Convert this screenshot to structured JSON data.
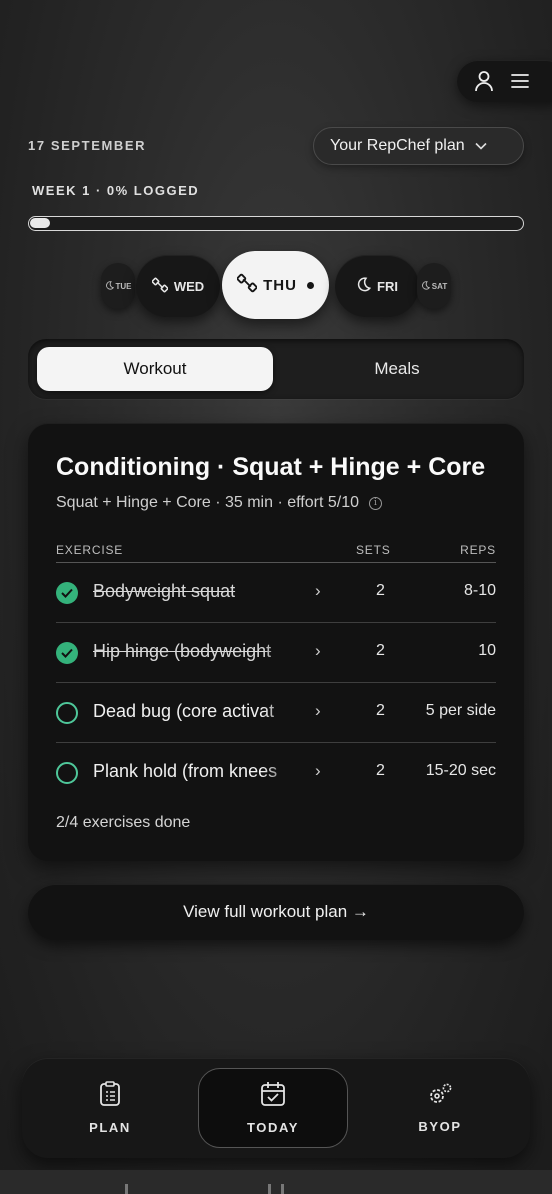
{
  "header": {
    "date": "17 SEPTEMBER",
    "plan_selector": "Your RepChef plan",
    "week_progress_label": "WEEK 1 · 0% LOGGED",
    "progress_fraction": 0.04
  },
  "days": [
    {
      "label": "TUE",
      "kind": "rest"
    },
    {
      "label": "WED",
      "kind": "workout"
    },
    {
      "label": "THU",
      "kind": "workout",
      "active": true
    },
    {
      "label": "FRI",
      "kind": "rest"
    },
    {
      "label": "SAT",
      "kind": "rest"
    }
  ],
  "tabs": {
    "workout": "Workout",
    "meals": "Meals"
  },
  "workout": {
    "title": "Conditioning · Squat + Hinge + Core",
    "subtitle": "Squat + Hinge + Core · 35 min · effort 5/10",
    "info_glyph": "i",
    "columns": {
      "exercise": "EXERCISE",
      "sets": "SETS",
      "reps": "REPS"
    },
    "exercises": [
      {
        "name": "Bodyweight squat",
        "sets": "2",
        "reps": "8-10",
        "done": true
      },
      {
        "name": "Hip hinge (bodyweight",
        "sets": "2",
        "reps": "10",
        "done": true
      },
      {
        "name": "Dead bug (core activat",
        "sets": "2",
        "reps": "5 per side",
        "done": false
      },
      {
        "name": "Plank hold (from knees",
        "sets": "2",
        "reps": "15-20 sec",
        "done": false
      }
    ],
    "done_summary": "2/4 exercises done"
  },
  "view_plan_button": "View full workout plan →",
  "nav": {
    "plan": "PLAN",
    "today": "TODAY",
    "byop": "BYOP"
  },
  "colors": {
    "accent_green": "#34b27b",
    "bg": "#2c2c2c",
    "card": "#121212"
  }
}
